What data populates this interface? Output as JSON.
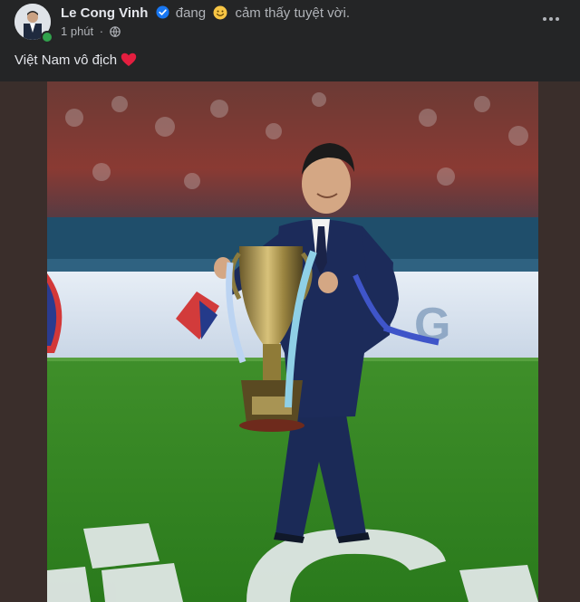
{
  "post": {
    "author": "Le Cong Vinh",
    "feeling_prefix": "đang",
    "feeling_text": "cảm thấy tuyệt vời.",
    "time": "1 phút",
    "separator": "·",
    "caption": "Việt Nam vô địch",
    "icons": {
      "avatar": "avatar",
      "verified": "verified-badge-icon",
      "feeling": "smiley-emoji-icon",
      "privacy": "globe-icon",
      "more": "more-options-icon",
      "heart": "heart-emoji-icon"
    }
  },
  "colors": {
    "background": "#242526",
    "text_primary": "#e4e6eb",
    "text_secondary": "#b0b3b8",
    "verified": "#1877f2",
    "heart": "#e41e3f",
    "online": "#31a24c",
    "pitch": "#2f8a1e",
    "suit": "#1a2a55"
  }
}
